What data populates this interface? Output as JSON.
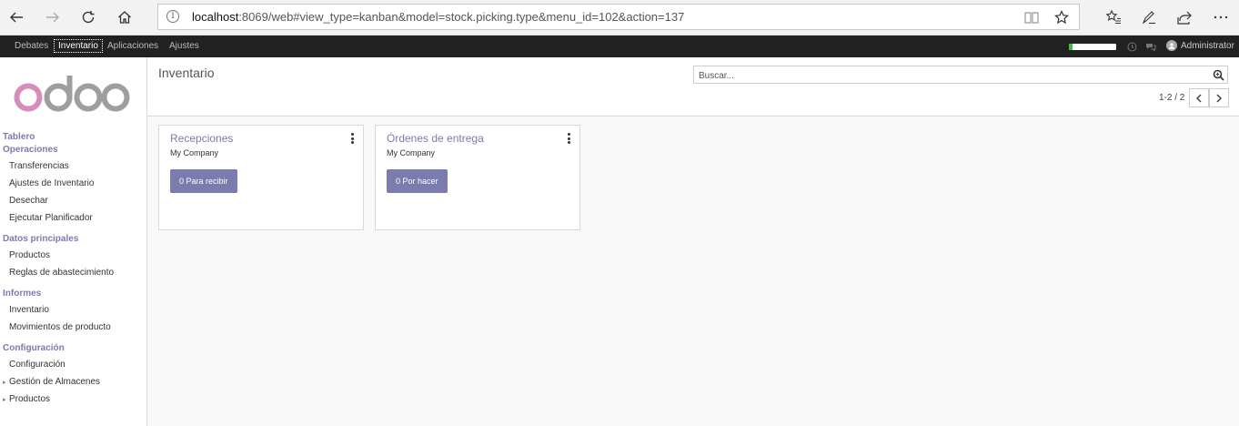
{
  "browser": {
    "url_host": "localhost",
    "url_rest": ":8069/web#view_type=kanban&model=stock.picking.type&menu_id=102&action=137",
    "info_glyph": "i"
  },
  "topbar": {
    "menus": [
      "Debates",
      "Inventario",
      "Aplicaciones",
      "Ajustes"
    ],
    "active_menu": "Inventario",
    "progress": 0.08,
    "user": "Administrator"
  },
  "sidebar": {
    "logo": "odoo",
    "dashboard": "Tablero",
    "sections": [
      {
        "title": "Operaciones",
        "items": [
          "Transferencias",
          "Ajustes de Inventario",
          "Desechar",
          "Ejecutar Planificador"
        ]
      },
      {
        "title": "Datos principales",
        "items": [
          "Productos",
          "Reglas de abastecimiento"
        ]
      },
      {
        "title": "Informes",
        "items": [
          "Inventario",
          "Movimientos de producto"
        ]
      },
      {
        "title": "Configuración",
        "items": [
          "Configuración",
          "Gestión de Almacenes",
          "Productos"
        ]
      }
    ]
  },
  "main": {
    "title": "Inventario",
    "search_placeholder": "Buscar...",
    "pager": "1-2 / 2",
    "cards": [
      {
        "title": "Recepciones",
        "company": "My Company",
        "button": "0 Para recibir"
      },
      {
        "title": "Órdenes de entrega",
        "company": "My Company",
        "button": "0 Por hacer"
      }
    ]
  },
  "colors": {
    "accent": "#7c7bad",
    "topbar": "#212121",
    "progress_fill": "#3ec04a"
  }
}
